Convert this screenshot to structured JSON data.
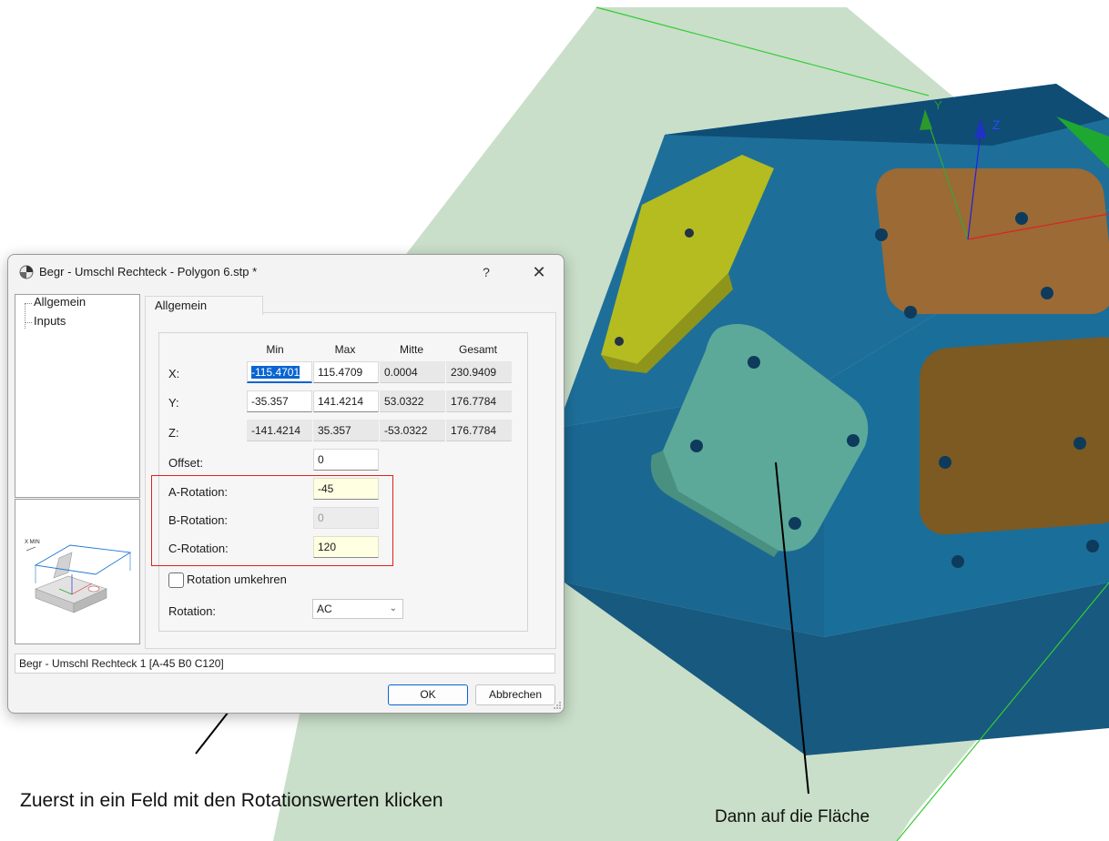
{
  "annotations": {
    "left_caption": "Zuerst in ein Feld mit den Rotationswerten klicken",
    "right_caption": "Dann auf die Fläche"
  },
  "viewport": {
    "axis_labels": {
      "y": "Y",
      "z": "Z"
    },
    "colors": {
      "solid_blue": "#1a6c98",
      "solid_blue_dark": "#0f4d75",
      "plane_green": "#c4dcc4",
      "face_yellow": "#b6be1e",
      "face_orange": "#8d5e2e",
      "face_teal": "#5ba89a",
      "face_brown": "#7a5a20"
    }
  },
  "dialog": {
    "title": "Begr - Umschl Rechteck - Polygon 6.stp *",
    "help_label": "?",
    "close_label": "✕",
    "tree": {
      "items": [
        {
          "label": "Allgemein",
          "selected": true
        },
        {
          "label": "Inputs",
          "selected": false
        }
      ]
    },
    "preview": {
      "label": "X MIN"
    },
    "tab_label": "Allgemein",
    "columns": [
      "Min",
      "Max",
      "Mitte",
      "Gesamt"
    ],
    "rows": [
      {
        "label": "X:",
        "min": "-115.4701",
        "max": "115.4709",
        "mitte": "0.0004",
        "gesamt": "230.9409"
      },
      {
        "label": "Y:",
        "min": "-35.357",
        "max": "141.4214",
        "mitte": "53.0322",
        "gesamt": "176.7784"
      },
      {
        "label": "Z:",
        "min": "-141.4214",
        "max": "35.357",
        "mitte": "-53.0322",
        "gesamt": "176.7784"
      }
    ],
    "offset": {
      "label": "Offset:",
      "value": "0"
    },
    "a_rotation": {
      "label": "A-Rotation:",
      "value": "-45"
    },
    "b_rotation": {
      "label": "B-Rotation:",
      "value": "0"
    },
    "c_rotation": {
      "label": "C-Rotation:",
      "value": "120"
    },
    "reverse_rotation": {
      "label": "Rotation umkehren",
      "checked": false
    },
    "rotation": {
      "label": "Rotation:",
      "value": "AC"
    },
    "status_text": "Begr - Umschl Rechteck 1 [A-45 B0 C120]",
    "ok_label": "OK",
    "cancel_label": "Abbrechen"
  }
}
